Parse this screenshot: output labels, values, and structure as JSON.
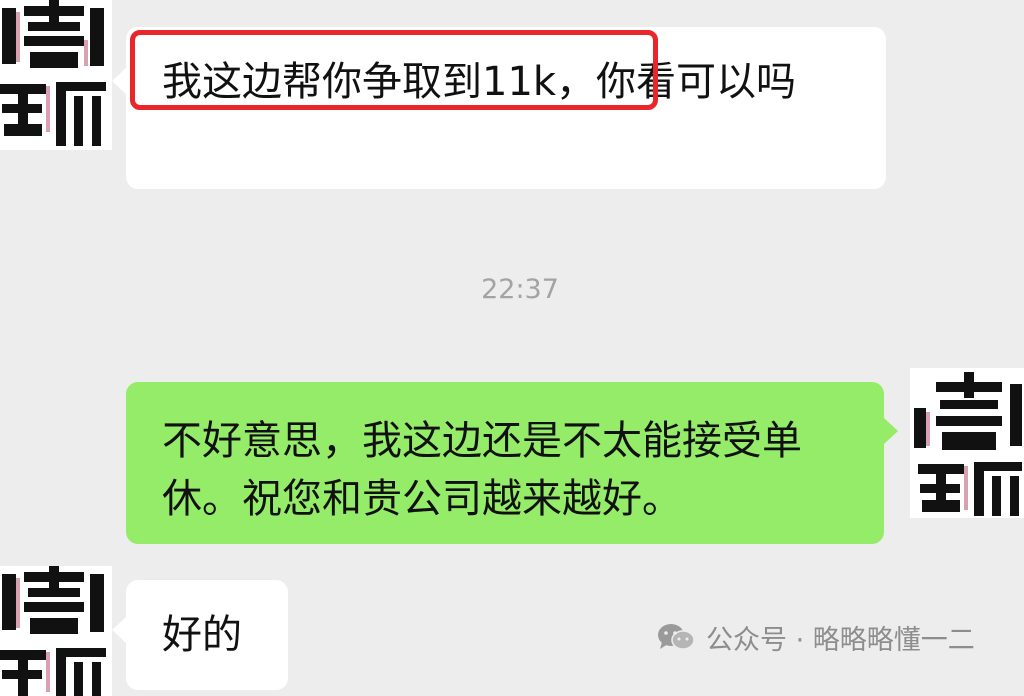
{
  "chat": {
    "messages": [
      {
        "side": "in",
        "text": "我这边帮你争取到11k，你看可以吗"
      },
      {
        "side": "out",
        "text": "不好意思，我这边还是不太能接受单休。祝您和贵公司越来越好。"
      },
      {
        "side": "in",
        "text": "好的"
      }
    ],
    "timestamp": "22:37"
  },
  "avatars": {
    "logo_text": "嘻唐"
  },
  "watermark": {
    "text": "公众号 · 略略略懂一二",
    "icon": "wechat-icon"
  },
  "colors": {
    "background": "#ededed",
    "incoming_bubble": "#ffffff",
    "outgoing_bubble": "#95ec69",
    "highlight": "#e8262b"
  }
}
